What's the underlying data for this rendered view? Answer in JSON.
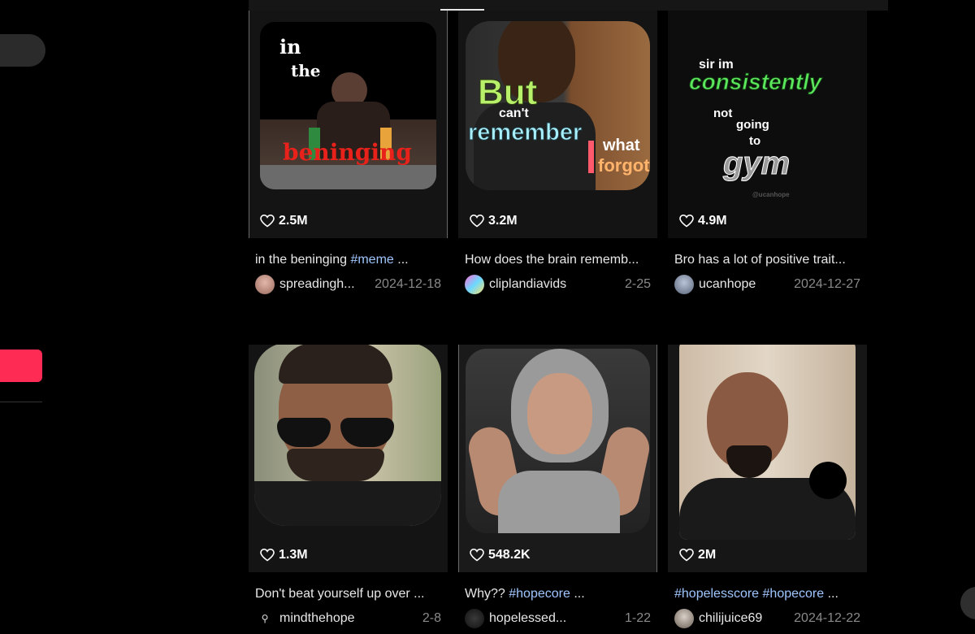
{
  "videos": [
    {
      "likes": "2.5M",
      "caption": "in the beninging ",
      "caption_tag": "#meme",
      "caption_more": " ...",
      "author": "spreadingh...",
      "date": "2024-12-18",
      "overlay": [
        "in",
        "the",
        "beninging"
      ]
    },
    {
      "likes": "3.2M",
      "caption": "How does the brain rememb...",
      "author": "cliplandiavids",
      "date": "2-25",
      "overlay": [
        "But",
        "can't",
        "remember",
        "what",
        "forgot"
      ]
    },
    {
      "likes": "4.9M",
      "caption": "Bro has a lot of positive trait...",
      "author": "ucanhope",
      "date": "2024-12-27",
      "overlay": [
        "sir im",
        "consistently",
        "not",
        "going",
        "to",
        "gym",
        "@ucanhope"
      ]
    },
    {
      "likes": "1.3M",
      "caption": "Don't beat yourself up over ...",
      "author": "mindthehope",
      "date": "2-8"
    },
    {
      "likes": "548.2K",
      "caption": "Why?? ",
      "caption_tag": "#hopecore",
      "caption_more": " ...",
      "author": "hopelessed...",
      "date": "1-22"
    },
    {
      "likes": "2M",
      "caption": "",
      "caption_tag": "#hopelesscore #hopecore",
      "caption_more": " ...",
      "author": "chilijuice69",
      "date": "2024-12-22"
    }
  ],
  "icons": {
    "like": "heart-outline-icon"
  },
  "colors": {
    "background": "#000000",
    "accent": "#fe2c55",
    "hashtag": "#9fc6ff",
    "muted": "#8a8a8a"
  }
}
